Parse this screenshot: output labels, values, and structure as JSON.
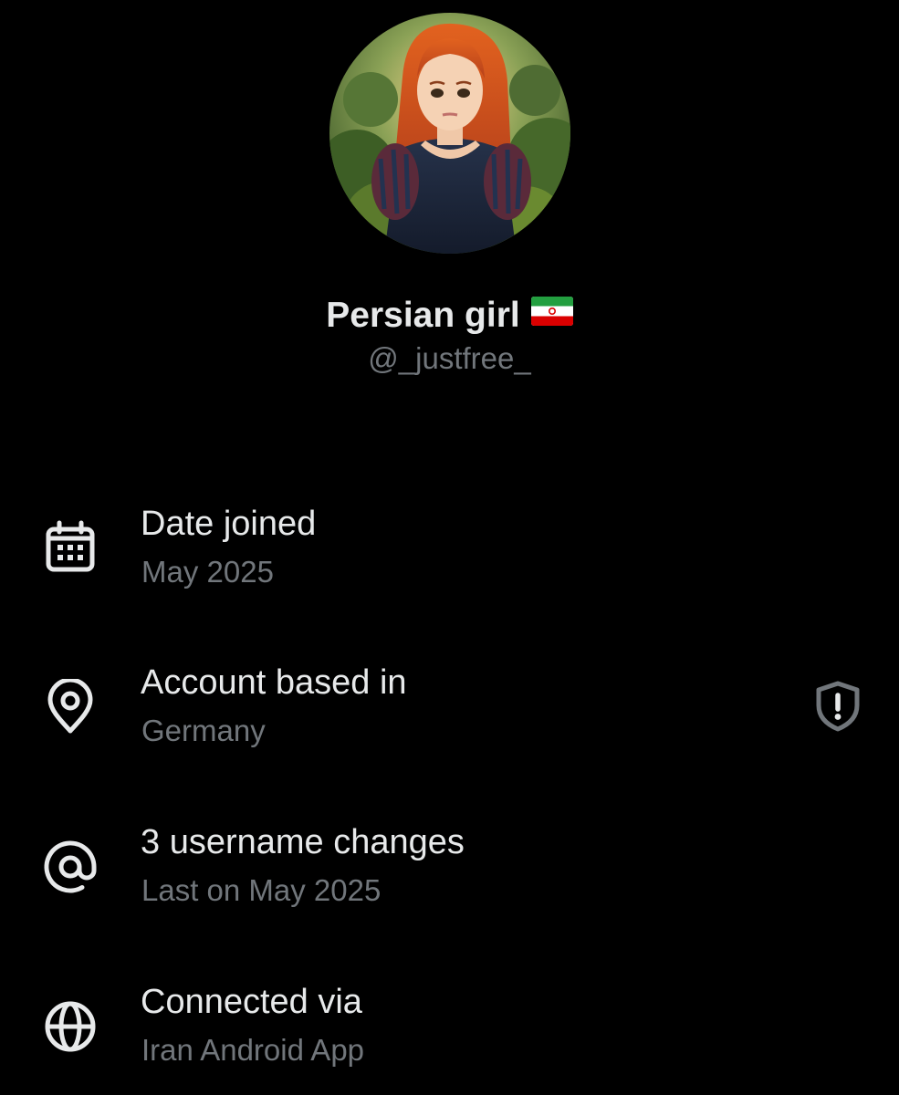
{
  "profile": {
    "display_name": "Persian girl",
    "handle": "@_justfree_",
    "avatar_icon": "profile-avatar",
    "name_emoji": "iran-flag"
  },
  "info": [
    {
      "icon": "calendar-icon",
      "title": "Date joined",
      "value": "May 2025"
    },
    {
      "icon": "location-pin-icon",
      "title": "Account based in",
      "value": "Germany",
      "right_icon": "shield-alert-icon"
    },
    {
      "icon": "at-sign-icon",
      "title": "3 username changes",
      "value": "Last on May 2025"
    },
    {
      "icon": "globe-icon",
      "title": "Connected via",
      "value": "Iran Android App"
    }
  ],
  "colors": {
    "background": "#000000",
    "primary_text": "#e7e9ea",
    "secondary_text": "#71767b",
    "icon": "#e7e9ea",
    "shield": "#71767b"
  }
}
